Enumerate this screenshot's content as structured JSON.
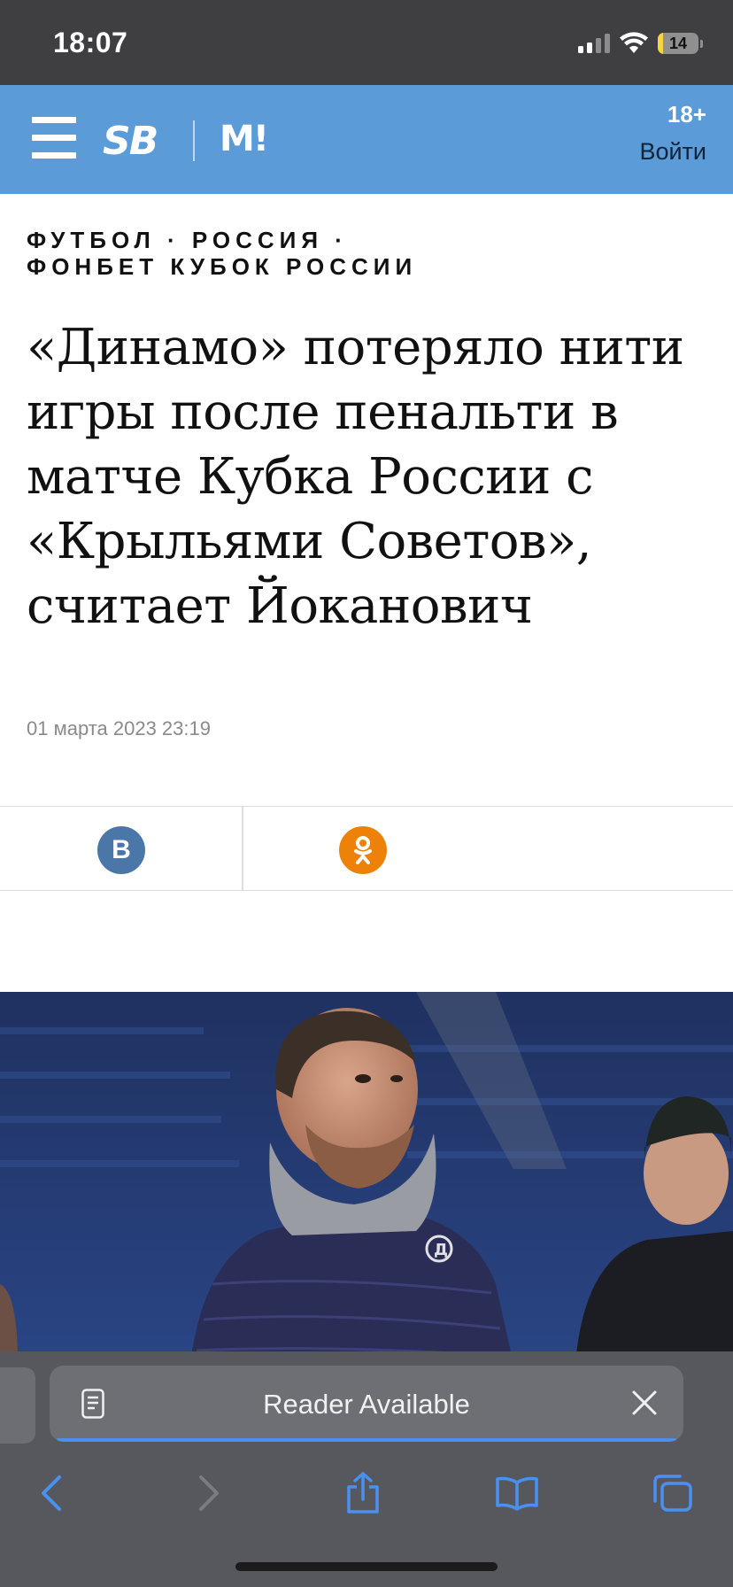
{
  "status_bar": {
    "time": "18:07",
    "battery": "14",
    "battery_level": 0.14
  },
  "header": {
    "logo_left": "SB",
    "logo_right": "M!",
    "age_rating": "18+",
    "login_label": "Войти"
  },
  "article": {
    "rubrics": [
      "Футбол",
      "Россия",
      "Фонбет Кубок России"
    ],
    "rubric_separator": "·",
    "title": "«Динамо» потеряло нити игры после пенальти в матче Кубка России с «Крыльями Советов», считает Йоканович",
    "date": "01 марта 2023 23:19"
  },
  "share": {
    "vk_label": "В",
    "vk_color": "#4a76a8",
    "ok_color": "#ee8208"
  },
  "safari": {
    "reader_label": "Reader Available",
    "accent": "#4a90f0"
  },
  "colors": {
    "header_bg": "#5b9bd8",
    "status_bg": "#3f3f41",
    "toolbar_bg": "#57585e"
  }
}
